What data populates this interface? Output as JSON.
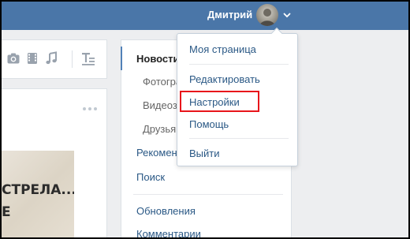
{
  "header": {
    "user_name": "Дмитрий",
    "accent_color": "#4a76a8"
  },
  "composer": {
    "icons": [
      "camera-icon",
      "video-icon",
      "music-icon",
      "text-format-icon"
    ]
  },
  "post": {
    "image_text_line1": "СТРЕЛА...",
    "image_text_line2": "Е"
  },
  "right_nav": {
    "items": [
      {
        "label": "Новости"
      },
      {
        "label": "Фотогра"
      },
      {
        "label": "Видеоз"
      },
      {
        "label": "Друзья"
      },
      {
        "label": "Рекомен"
      },
      {
        "label": "Поиск"
      },
      {
        "label": "Обновления"
      },
      {
        "label": "Комментарии"
      }
    ]
  },
  "dropdown": {
    "items": [
      {
        "label": "Моя страница"
      },
      {
        "label": "Редактировать"
      },
      {
        "label": "Настройки",
        "highlighted": true
      },
      {
        "label": "Помощь"
      },
      {
        "label": "Выйти"
      }
    ],
    "highlight_color": "#e8151b"
  }
}
